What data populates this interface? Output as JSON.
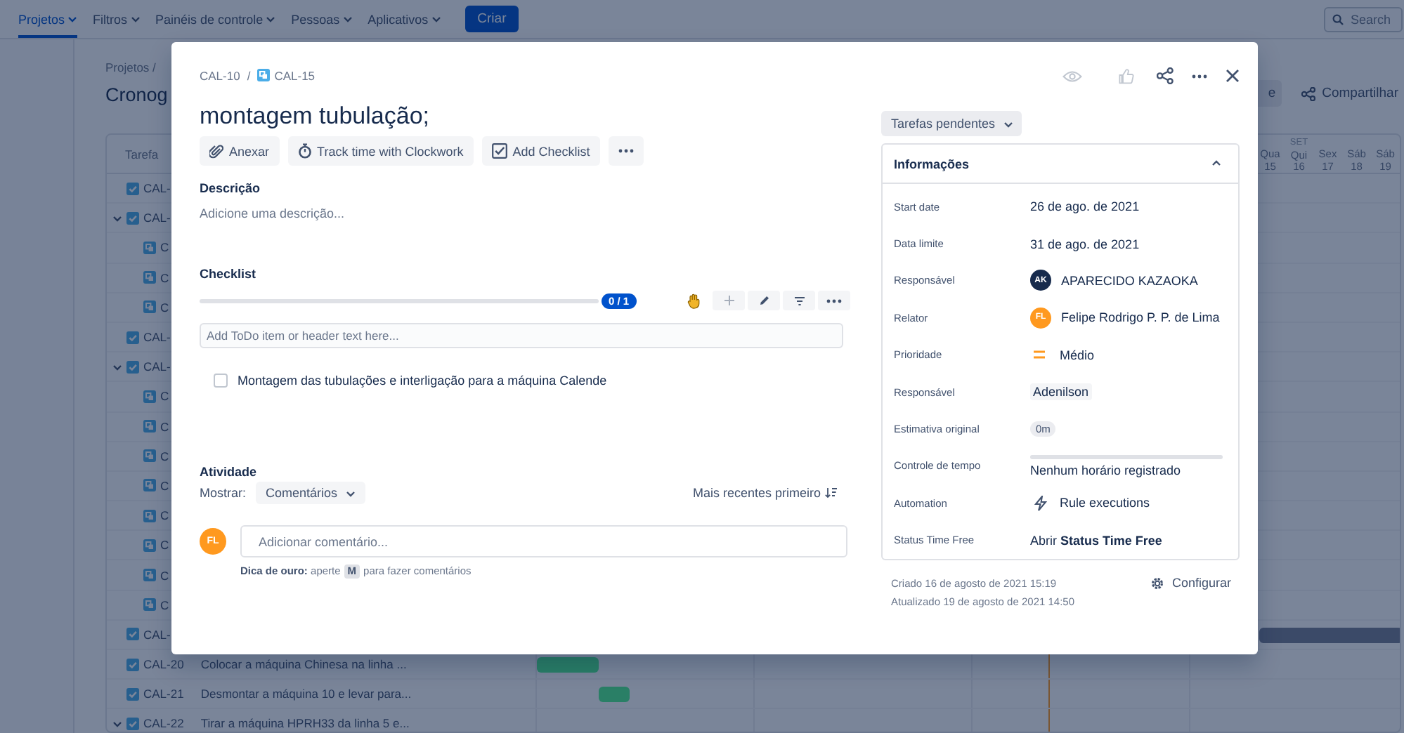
{
  "nav": {
    "items": [
      {
        "label": "Projetos",
        "selected": true
      },
      {
        "label": "Filtros",
        "selected": false
      },
      {
        "label": "Painéis de controle",
        "selected": false
      },
      {
        "label": "Pessoas",
        "selected": false
      },
      {
        "label": "Aplicativos",
        "selected": false
      }
    ],
    "create_button": "Criar",
    "search": {
      "placeholder": "Search"
    }
  },
  "page": {
    "breadcrumb": "Projetos /",
    "title": "Cronog",
    "header_button": "e",
    "share_button": "Compartilhar",
    "table": {
      "column": "Tarefa",
      "rows": [
        {
          "kind": "task",
          "key": "CAL-"
        },
        {
          "kind": "parent",
          "key": "CAL-",
          "expanded": true
        },
        {
          "kind": "subtask",
          "key": "C"
        },
        {
          "kind": "subtask",
          "key": "C"
        },
        {
          "kind": "subtask",
          "key": "C"
        },
        {
          "kind": "task",
          "key": "CAL-"
        },
        {
          "kind": "parent",
          "key": "CAL-",
          "expanded": true
        },
        {
          "kind": "subtask",
          "key": "C"
        },
        {
          "kind": "subtask",
          "key": "C"
        },
        {
          "kind": "subtask",
          "key": "C"
        },
        {
          "kind": "subtask",
          "key": "C"
        },
        {
          "kind": "subtask",
          "key": "C"
        },
        {
          "kind": "subtask",
          "key": "C"
        },
        {
          "kind": "subtask",
          "key": "C"
        },
        {
          "kind": "subtask",
          "key": "C"
        },
        {
          "kind": "task",
          "key": "CAL-",
          "color": "#3b4a68"
        },
        {
          "kind": "task",
          "key": "CAL-20",
          "summary": "Colocar a máquina Chinesa na linha ...",
          "color": "#2a7f66"
        },
        {
          "kind": "task",
          "key": "CAL-21",
          "summary": "Desmontar a máquina 10 e levar para...",
          "color": "#2a7f66"
        },
        {
          "kind": "parent",
          "key": "CAL-22",
          "summary": "Tirar a máquina HPRH33 da linha 5 e...",
          "expanded": true
        }
      ]
    },
    "timeline": {
      "days": [
        {
          "weekday": "Qua",
          "day": "15"
        },
        {
          "weekday": "Qui",
          "day": "16",
          "month": "SET"
        },
        {
          "weekday": "Sex",
          "day": "17"
        },
        {
          "weekday": "Sáb",
          "day": "18"
        },
        {
          "weekday": "Sáb",
          "day": "19"
        }
      ]
    }
  },
  "issue": {
    "breadcrumbs": [
      {
        "key": "CAL-10",
        "kind": "parent"
      },
      {
        "key": "CAL-15",
        "kind": "subtask"
      }
    ],
    "separator": "/",
    "title": "montagem tubulação;",
    "actions": [
      {
        "label": "Anexar",
        "kind": "attach"
      },
      {
        "label": "Track time with Clockwork",
        "kind": "timer"
      },
      {
        "label": "Add Checklist",
        "kind": "checklist"
      },
      {
        "kind": "more"
      }
    ],
    "description": {
      "heading": "Descrição",
      "placeholder": "Adicione uma descrição..."
    },
    "checklist": {
      "heading": "Checklist",
      "level": 0,
      "progress": "0 / 1",
      "input": {
        "placeholder": "Add ToDo item or header text here..."
      },
      "items": [
        {
          "text": "Montagem das tubulações e interligação para a máquina Calende",
          "checked": false
        }
      ]
    },
    "activity": {
      "heading": "Atividade",
      "show_label": "Mostrar:",
      "filter": "Comentários",
      "sort": "Mais recentes primeiro",
      "avatar": {
        "initials": "FL",
        "color": "#ff991f"
      },
      "comment": {
        "placeholder": "Adicionar comentário..."
      },
      "tip_before": "**Dica de ouro:** aperte",
      "tip_key": "M",
      "tip_after": "para fazer comentários"
    },
    "status": "Tarefas pendentes",
    "details": {
      "heading": "Informações",
      "expanded": true,
      "fields": [
        {
          "label": "Start date",
          "kind": "text",
          "value": "26 de ago. de 2021"
        },
        {
          "label": "Data limite",
          "kind": "text",
          "value": "31 de ago. de 2021"
        },
        {
          "label": "Responsável",
          "kind": "user",
          "initials": "AK",
          "color": "#172b4d",
          "value": "APARECIDO KAZAOKA"
        },
        {
          "label": "Relator",
          "kind": "user",
          "initials": "FL",
          "color": "#ff991f",
          "value": "Felipe Rodrigo P. P. de Lima"
        },
        {
          "label": "Prioridade",
          "kind": "priority",
          "value": "Médio"
        },
        {
          "label": "Responsável",
          "kind": "tag",
          "value": "Adenilson"
        },
        {
          "label": "Estimativa original",
          "kind": "chip",
          "value": "0m"
        },
        {
          "label": "Controle de tempo",
          "kind": "timetracking",
          "value": "Nenhum horário registrado"
        },
        {
          "label": "Automation",
          "kind": "automation",
          "value": "Rule executions"
        },
        {
          "label": "Status Time Free",
          "kind": "link",
          "value": "Abrir **Status Time Free**"
        }
      ]
    },
    "created": "Criado 16 de agosto de 2021 15:19",
    "updated": "Atualizado 19 de agosto de 2021 14:50",
    "configure": "Configurar"
  }
}
